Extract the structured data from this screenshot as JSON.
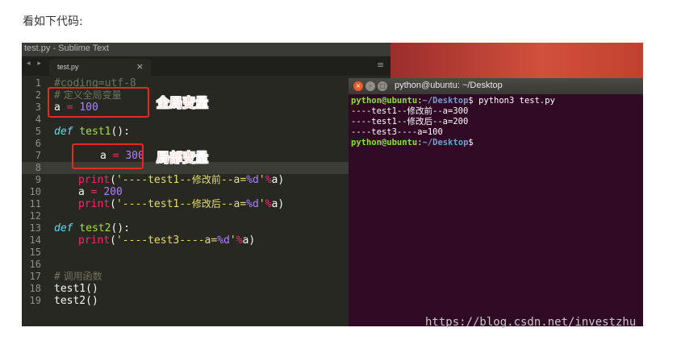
{
  "intro_text": "看如下代码:",
  "sublime": {
    "title": "test.py - Sublime Text",
    "tab_label": "test.py",
    "tab_nav_icon": "◂ ▸",
    "tab_close_icon": "×",
    "menu_icon": "≡",
    "line_numbers": [
      "1",
      "2",
      "3",
      "4",
      "5",
      "6",
      "7",
      "8",
      "9",
      "10",
      "11",
      "12",
      "13",
      "14",
      "15",
      "16",
      "17",
      "18",
      "19"
    ],
    "code": {
      "l1": "#coding=utf-8",
      "l2_hash": "#",
      "l2_text": " 定义全局变量",
      "l3_var": "a",
      "l3_op": " = ",
      "l3_num": "100",
      "l5_def": "def",
      "l5_name": " test1",
      "l5_rest": "():",
      "l7_var": "a",
      "l7_op": " = ",
      "l7_num": "300",
      "l9_print": "print",
      "l9_open": "(",
      "l9_str1": "'----test1--",
      "l9_cjk": "修改前",
      "l9_str2": "--a=",
      "l9_fmt": "%d",
      "l9_str3": "'",
      "l9_pct": "%",
      "l9_end": "a)",
      "l10_var": "a",
      "l10_op": " = ",
      "l10_num": "200",
      "l11_print": "print",
      "l11_open": "(",
      "l11_str1": "'----test1--",
      "l11_cjk": "修改后",
      "l11_str2": "--a=",
      "l11_fmt": "%d",
      "l11_str3": "'",
      "l11_pct": "%",
      "l11_end": "a)",
      "l13_def": "def",
      "l13_name": " test2",
      "l13_rest": "():",
      "l14_print": "print",
      "l14_open": "(",
      "l14_str1": "'----test3----a=",
      "l14_fmt": "%d",
      "l14_str3": "'",
      "l14_pct": "%",
      "l14_end": "a)",
      "l17_hash": "#",
      "l17_text": " 调用函数",
      "l18": "test1()",
      "l19": "test2()"
    },
    "annotations": {
      "global_label": "全局变量",
      "local_label": "局部变量"
    }
  },
  "terminal": {
    "title": "python@ubuntu: ~/Desktop",
    "close_icon": "×",
    "min_icon": "–",
    "max_icon": "□",
    "prompt_user": "python@ubuntu",
    "prompt_colon": ":",
    "prompt_path": "~/Desktop",
    "prompt_sign": "$",
    "command": " python3 test.py",
    "out1": "----test1--修改前--a=300",
    "out2": "----test1--修改后--a=200",
    "out3": "----test3----a=100"
  },
  "watermark": "https://blog.csdn.net/investzhu",
  "colors": {
    "editor_bg": "#272822",
    "terminal_bg": "#300a24",
    "annotation_red": "#e52b1f"
  }
}
